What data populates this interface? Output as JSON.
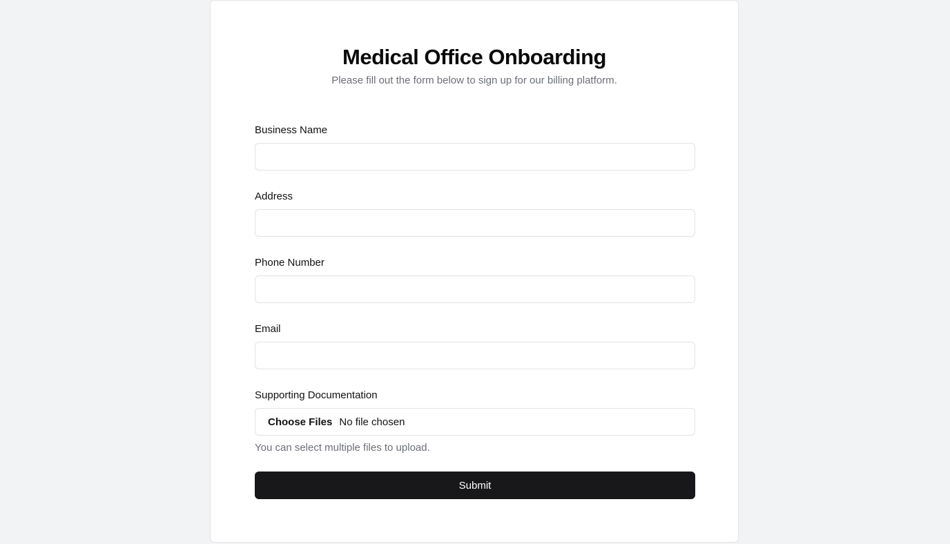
{
  "page": {
    "title": "Medical Office Onboarding",
    "subtitle": "Please fill out the form below to sign up for our billing platform."
  },
  "form": {
    "business_name": {
      "label": "Business Name",
      "value": "",
      "placeholder": ""
    },
    "address": {
      "label": "Address",
      "value": "",
      "placeholder": ""
    },
    "phone": {
      "label": "Phone Number",
      "value": "",
      "placeholder": ""
    },
    "email": {
      "label": "Email",
      "value": "",
      "placeholder": ""
    },
    "documents": {
      "label": "Supporting Documentation",
      "button_label": "Choose Files",
      "status": "No file chosen",
      "hint": "You can select multiple files to upload."
    },
    "submit_label": "Submit"
  },
  "colors": {
    "background": "#f2f3f5",
    "card": "#ffffff",
    "button": "#18181b",
    "muted_text": "#6b6f76"
  }
}
